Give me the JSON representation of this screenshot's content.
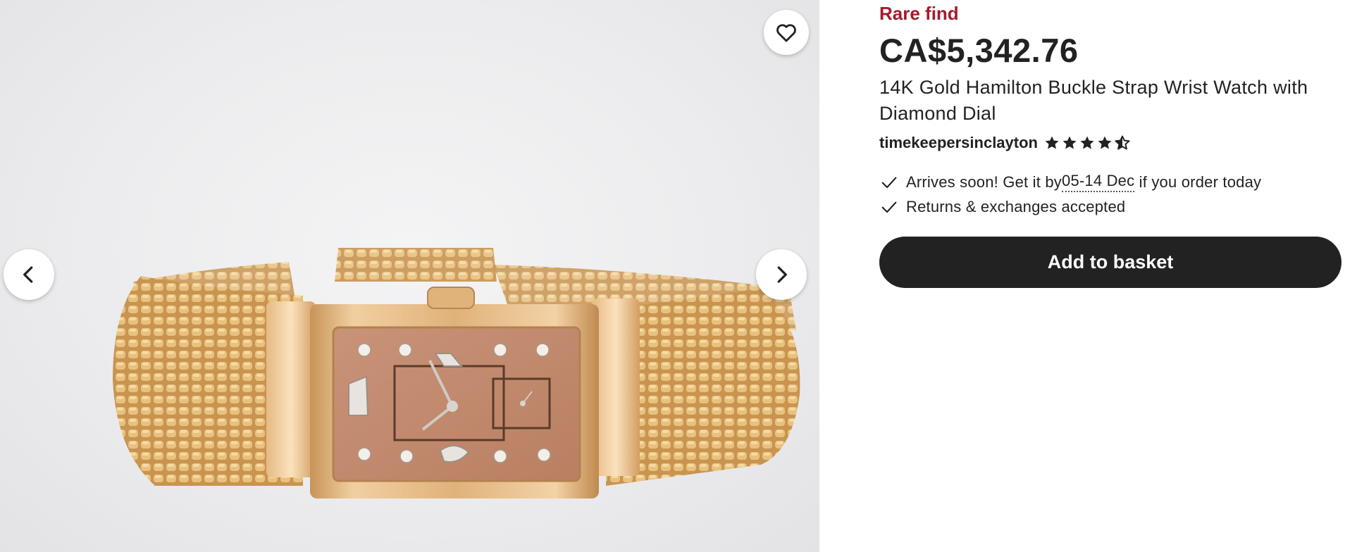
{
  "gallery": {
    "favorite_icon": "heart-outline-icon",
    "prev_icon": "chevron-left-icon",
    "next_icon": "chevron-right-icon"
  },
  "listing": {
    "badge": "Rare find",
    "price": "CA$5,342.76",
    "title": "14K Gold Hamilton Buckle Strap Wrist Watch with Diamond Dial",
    "seller": "timekeepersinclayton",
    "rating": 4.5,
    "rating_max": 5
  },
  "delivery": {
    "arrives_prefix": "Arrives soon! Get it by ",
    "arrives_dates": "05-14 Dec",
    "arrives_suffix": " if you order today",
    "returns": "Returns & exchanges accepted"
  },
  "actions": {
    "add_to_basket": "Add to basket"
  },
  "colors": {
    "badge": "#a61a2e",
    "button": "#222222",
    "gold": "#d8aa6a"
  }
}
